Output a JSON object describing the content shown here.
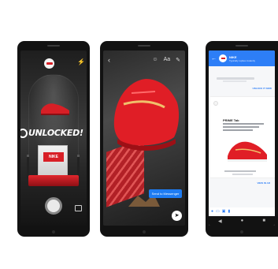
{
  "banner": {
    "text": "UNLOCKED!"
  },
  "box_label": "NIKE",
  "ar_send": {
    "label": "Send to Messenger"
  },
  "messenger": {
    "page_name": "NIKE",
    "page_sub": "Typically replies instantly",
    "link_1": "UNLOCK IT NOW",
    "link_2": "VIEW IN AR",
    "card_title": "PRIME Tab"
  },
  "colors": {
    "accent": "#d81f26",
    "messenger_blue": "#2d7ef7"
  }
}
